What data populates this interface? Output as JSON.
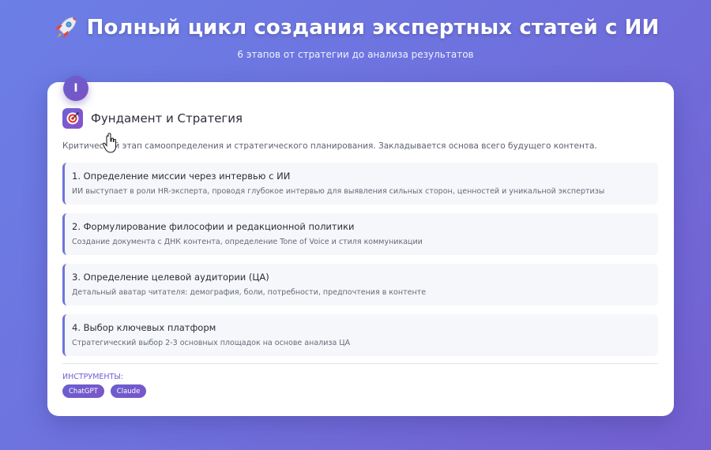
{
  "header": {
    "title": "Полный цикл создания экспертных статей с ИИ",
    "subtitle": "6 этапов от стратегии до анализа результатов",
    "icon": "rocket-icon"
  },
  "stage": {
    "number": "I",
    "icon": "target-icon",
    "title": "Фундамент и Стратегия",
    "description": "Критический этап самоопределения и стратегического планирования. Закладывается основа всего будущего контента."
  },
  "steps": [
    {
      "title": "1. Определение миссии через интервью с ИИ",
      "text": "ИИ выступает в роли HR-эксперта, проводя глубокое интервью для выявления сильных сторон, ценностей и уникальной экспертизы"
    },
    {
      "title": "2. Формулирование философии и редакционной политики",
      "text": "Создание документа с ДНК контента, определение Tone of Voice и стиля коммуникации"
    },
    {
      "title": "3. Определение целевой аудитории (ЦА)",
      "text": "Детальный аватар читателя: демография, боли, потребности, предпочтения в контенте"
    },
    {
      "title": "4. Выбор ключевых платформ",
      "text": "Стратегический выбор 2-3 основных площадок на основе анализа ЦА"
    }
  ],
  "tools": {
    "label": "ИНСТРУМЕНТЫ:",
    "items": [
      "ChatGPT",
      "Claude"
    ]
  },
  "colors": {
    "background_start": "#6b7fe6",
    "background_end": "#7460d0",
    "accent": "#6f5fd6",
    "step_border": "#6f74dd"
  }
}
